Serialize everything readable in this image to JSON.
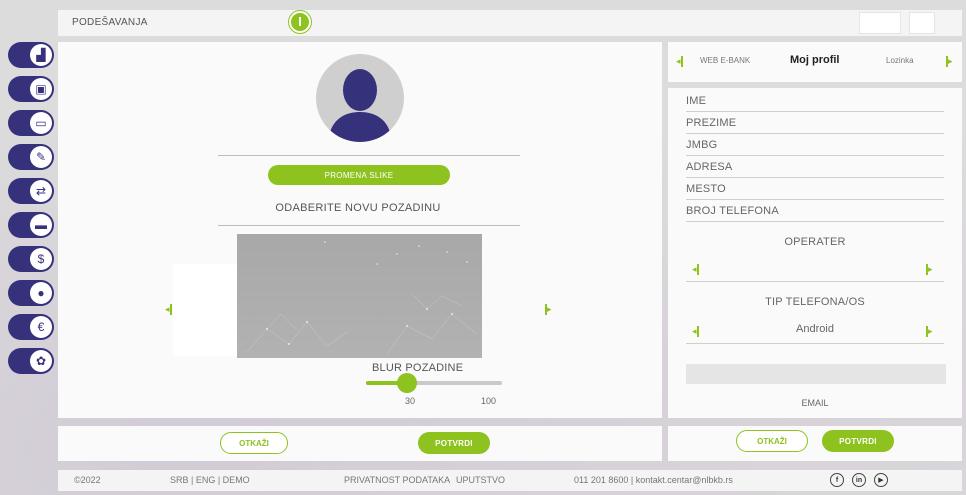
{
  "header": {
    "title": "PODEŠAVANJA"
  },
  "nav": [
    {
      "icon": "chart-icon"
    },
    {
      "icon": "briefcase-icon"
    },
    {
      "icon": "card-icon"
    },
    {
      "icon": "payment-icon"
    },
    {
      "icon": "transfer-icon"
    },
    {
      "icon": "minus-card-icon"
    },
    {
      "icon": "dollar-icon"
    },
    {
      "icon": "location-icon"
    },
    {
      "icon": "euro-icon"
    },
    {
      "icon": "settings-icon"
    }
  ],
  "main": {
    "change_picture": "PROMENA SLIKE",
    "choose_background": "ODABERITE NOVU POZADINU",
    "blur_label": "BLUR POZADINE",
    "blur_value": 30,
    "blur_max": 100,
    "blur_value_text": "30",
    "blur_max_text": "100",
    "cancel": "OTKAŽI",
    "confirm": "POTVRDI"
  },
  "right": {
    "tabs": [
      "WEB E-BANK",
      "Moj profil",
      "Lozinka"
    ],
    "fields": [
      "IME",
      "PREZIME",
      "JMBG",
      "ADRESA",
      "MESTO",
      "BROJ TELEFONA"
    ],
    "operator_label": "OPERATER",
    "operator_value": "",
    "phone_type_label": "TIP TELEFONA/OS",
    "phone_type_value": "Android",
    "email_label": "EMAIL",
    "cancel": "OTKAŽI",
    "confirm": "POTVRDI"
  },
  "footer": {
    "copyright": "©2022",
    "languages": "SRB  |  ENG  |  DEMO",
    "privacy": "PRIVATNOST PODATAKA",
    "guide": "UPUTSTVO",
    "contact": "011 201 8600  |  kontakt.centar@nlbkb.rs",
    "social": [
      "f",
      "in",
      "▶"
    ]
  },
  "colors": {
    "accent": "#8dc21f",
    "nav": "#36317b"
  }
}
